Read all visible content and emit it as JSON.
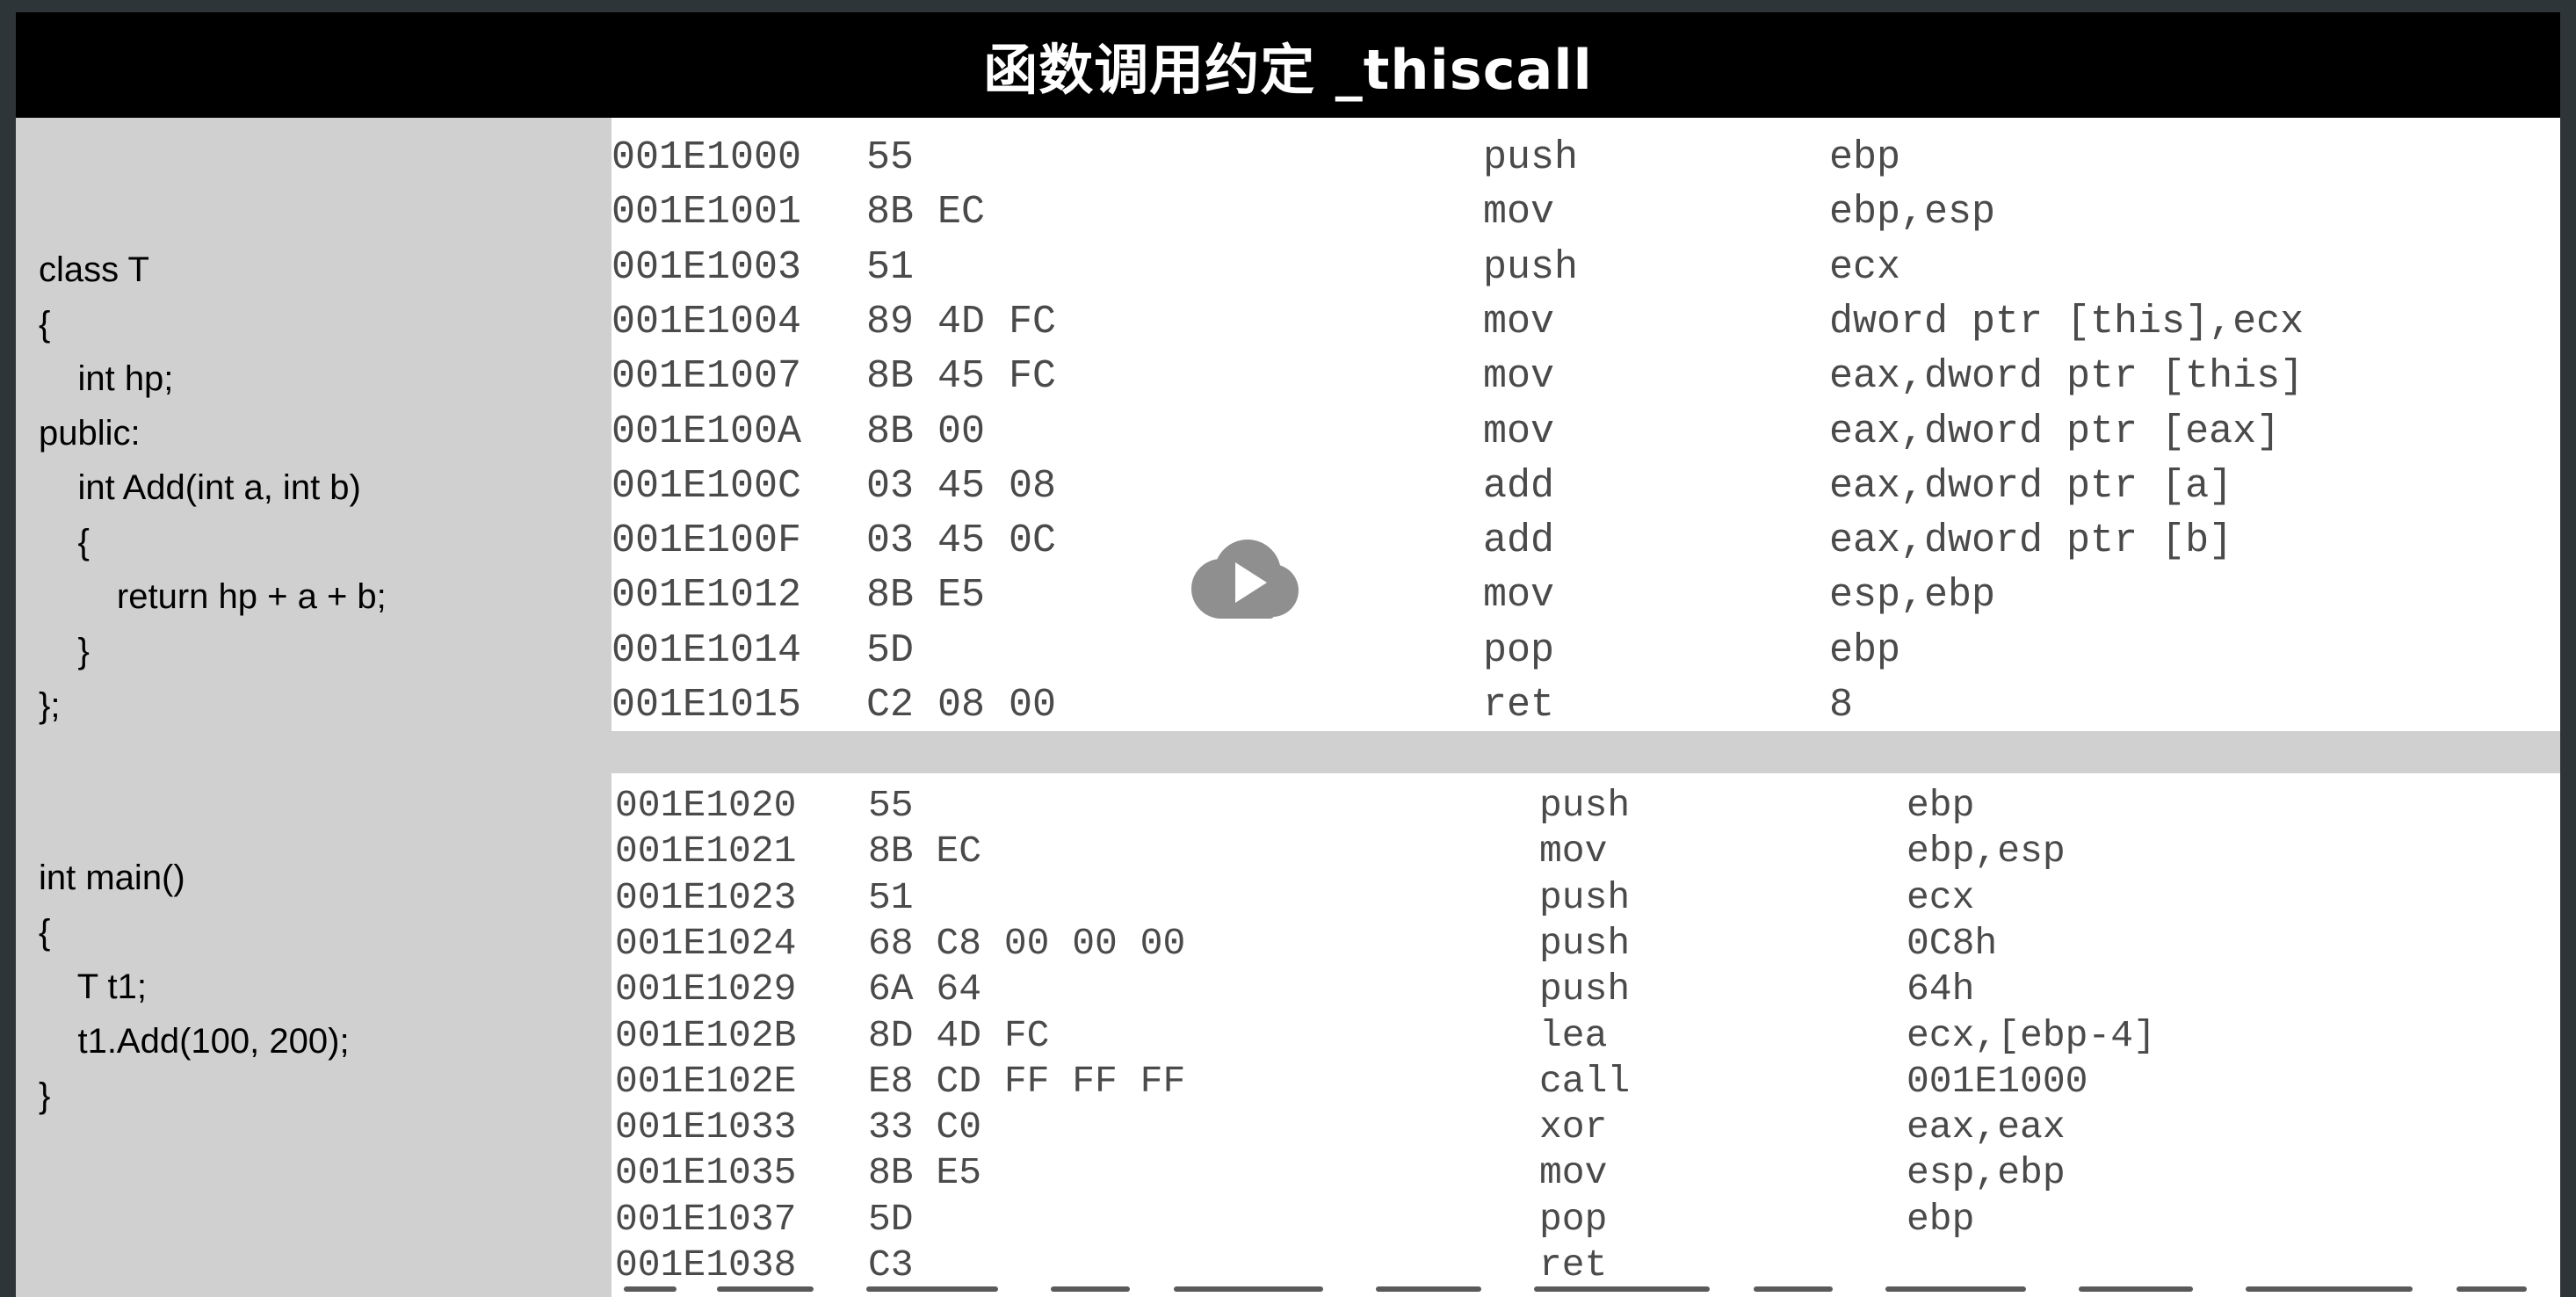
{
  "slide": {
    "title": "函数调用约定 _thiscall"
  },
  "code": {
    "class_lines": [
      "class T",
      "{",
      "    int hp;",
      "public:",
      "    int Add(int a, int b)",
      "    {",
      "        return hp + a + b;",
      "    }",
      "};"
    ],
    "main_lines": [
      "int main()",
      "{",
      "    T t1;",
      "    t1.Add(100, 200);",
      "}"
    ]
  },
  "disasm_top": [
    {
      "addr": "001E1000",
      "bytes": "55",
      "mnemonic": "push",
      "operands": "ebp"
    },
    {
      "addr": "001E1001",
      "bytes": "8B EC",
      "mnemonic": "mov",
      "operands": "ebp,esp"
    },
    {
      "addr": "001E1003",
      "bytes": "51",
      "mnemonic": "push",
      "operands": "ecx"
    },
    {
      "addr": "001E1004",
      "bytes": "89 4D FC",
      "mnemonic": "mov",
      "operands": "dword ptr [this],ecx"
    },
    {
      "addr": "001E1007",
      "bytes": "8B 45 FC",
      "mnemonic": "mov",
      "operands": "eax,dword ptr [this]"
    },
    {
      "addr": "001E100A",
      "bytes": "8B 00",
      "mnemonic": "mov",
      "operands": "eax,dword ptr [eax]"
    },
    {
      "addr": "001E100C",
      "bytes": "03 45 08",
      "mnemonic": "add",
      "operands": "eax,dword ptr [a]"
    },
    {
      "addr": "001E100F",
      "bytes": "03 45 0C",
      "mnemonic": "add",
      "operands": "eax,dword ptr [b]"
    },
    {
      "addr": "001E1012",
      "bytes": "8B E5",
      "mnemonic": "mov",
      "operands": "esp,ebp"
    },
    {
      "addr": "001E1014",
      "bytes": "5D",
      "mnemonic": "pop",
      "operands": "ebp"
    },
    {
      "addr": "001E1015",
      "bytes": "C2 08 00",
      "mnemonic": "ret",
      "operands": "8"
    }
  ],
  "disasm_bottom": [
    {
      "addr": "001E1020",
      "bytes": "55",
      "mnemonic": "push",
      "operands": "ebp"
    },
    {
      "addr": "001E1021",
      "bytes": "8B EC",
      "mnemonic": "mov",
      "operands": "ebp,esp"
    },
    {
      "addr": "001E1023",
      "bytes": "51",
      "mnemonic": "push",
      "operands": "ecx"
    },
    {
      "addr": "001E1024",
      "bytes": "68 C8 00 00 00",
      "mnemonic": "push",
      "operands": "0C8h"
    },
    {
      "addr": "001E1029",
      "bytes": "6A 64",
      "mnemonic": "push",
      "operands": "64h"
    },
    {
      "addr": "001E102B",
      "bytes": "8D 4D FC",
      "mnemonic": "lea",
      "operands": "ecx,[ebp-4]"
    },
    {
      "addr": "001E102E",
      "bytes": "E8 CD FF FF FF",
      "mnemonic": "call",
      "operands": "001E1000"
    },
    {
      "addr": "001E1033",
      "bytes": "33 C0",
      "mnemonic": "xor",
      "operands": "eax,eax"
    },
    {
      "addr": "001E1035",
      "bytes": "8B E5",
      "mnemonic": "mov",
      "operands": "esp,ebp"
    },
    {
      "addr": "001E1037",
      "bytes": "5D",
      "mnemonic": "pop",
      "operands": "ebp"
    },
    {
      "addr": "001E1038",
      "bytes": "C3",
      "mnemonic": "ret",
      "operands": ""
    }
  ],
  "player": {
    "play_icon": "play-icon"
  },
  "colors": {
    "title_bg": "#000000",
    "title_text": "#ffffff",
    "slide_bg": "#d0d0d0",
    "panel_bg": "#ffffff",
    "asm_text": "#4a4a4a",
    "frame_bg": "#2e3538",
    "play_overlay": "#8a8a8a"
  }
}
